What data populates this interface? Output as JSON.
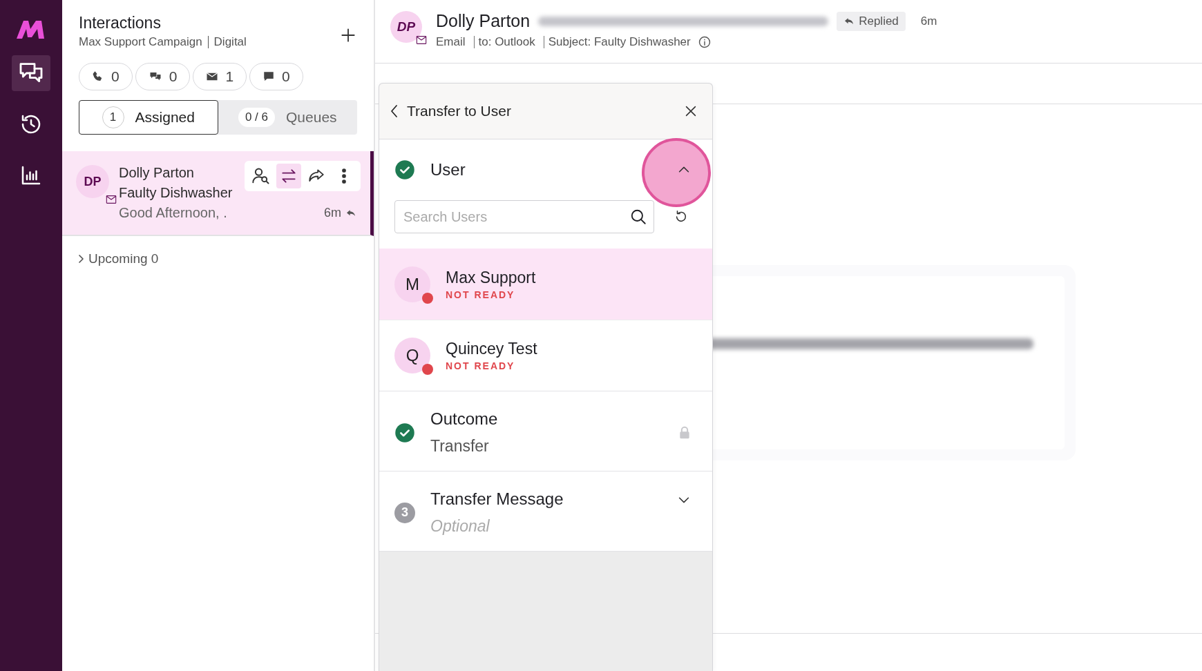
{
  "nav": {
    "items": [
      {
        "kind": "chat",
        "selected": true
      },
      {
        "kind": "history",
        "selected": false
      },
      {
        "kind": "reports",
        "selected": false
      }
    ]
  },
  "interactions": {
    "title": "Interactions",
    "campaign": "Max Support Campaign",
    "channel": "Digital",
    "counters": [
      {
        "kind": "phone",
        "count": "0"
      },
      {
        "kind": "chat",
        "count": "0"
      },
      {
        "kind": "email",
        "count": "1"
      },
      {
        "kind": "sms",
        "count": "0"
      }
    ],
    "tabs": [
      {
        "label": "Assigned",
        "count": "1",
        "selected": true
      },
      {
        "label": "Queues",
        "count": "0 / 6",
        "selected": false
      }
    ],
    "items": [
      {
        "initials": "DP",
        "name": "Dolly Parton",
        "subject": "Faulty Dishwasher",
        "preview": "Good Afternoon, .",
        "time": "6m",
        "selected": true
      }
    ],
    "upcoming": {
      "label": "Upcoming 0",
      "expanded": false
    }
  },
  "header": {
    "initials": "DP",
    "name": "Dolly Parton",
    "status": "Replied",
    "time": "6m",
    "channel": "Email",
    "to": "to: Outlook",
    "subject": "Subject: Faulty Dishwasher"
  },
  "transfer": {
    "title": "Transfer to User",
    "steps": [
      {
        "kind": "users",
        "label": "User",
        "done": true,
        "expanded": true,
        "search_placeholder": "Search Users",
        "users": [
          {
            "initial": "M",
            "name": "Max Support",
            "status": "NOT READY",
            "color": "#e0464c",
            "selected": true
          },
          {
            "initial": "Q",
            "name": "Quincey Test",
            "status": "NOT READY",
            "color": "#e0464c",
            "selected": false
          }
        ]
      },
      {
        "kind": "locked",
        "label": "Outcome",
        "value": "Transfer",
        "done": true
      },
      {
        "kind": "collapsed",
        "label": "Transfer Message",
        "number": "3",
        "value": "Optional",
        "done": false,
        "expanded": false
      }
    ]
  }
}
